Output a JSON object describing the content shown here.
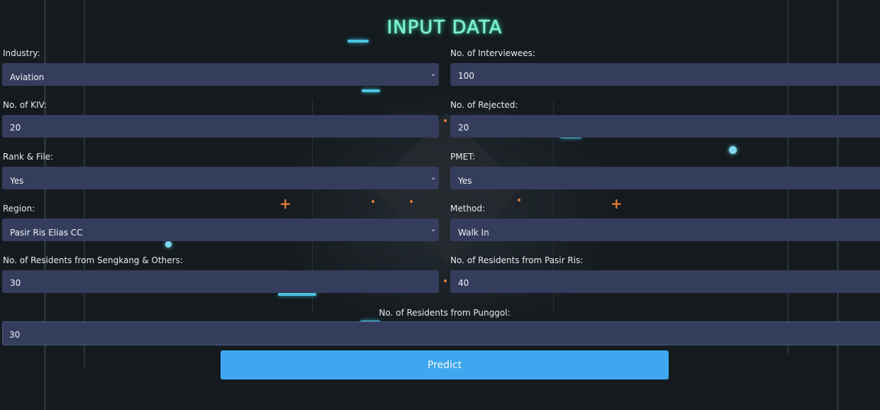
{
  "title": "INPUT DATA",
  "fields": {
    "industry": {
      "label": "Industry:",
      "value": "Aviation"
    },
    "interviewees": {
      "label": "No. of Interviewees:",
      "value": "100"
    },
    "kiv": {
      "label": "No. of KIV:",
      "value": "20"
    },
    "rejected": {
      "label": "No. of Rejected:",
      "value": "20"
    },
    "rank_file": {
      "label": "Rank & File:",
      "value": "Yes"
    },
    "pmet": {
      "label": "PMET:",
      "value": "Yes"
    },
    "region": {
      "label": "Region:",
      "value": "Pasir Ris Elias CC"
    },
    "method": {
      "label": "Method:",
      "value": "Walk In"
    },
    "sengkang": {
      "label": "No. of Residents from Sengkang & Others:",
      "value": "30"
    },
    "pasir_ris": {
      "label": "No. of Residents from Pasir Ris:",
      "value": "40"
    },
    "punggol": {
      "label": "No. of Residents from Punggol:",
      "value": "30"
    }
  },
  "predict_label": "Predict",
  "colors": {
    "background": "#141a1e",
    "field": "#343d5c",
    "button": "#3ea7f0",
    "title_glow": "#7ff5d0"
  }
}
